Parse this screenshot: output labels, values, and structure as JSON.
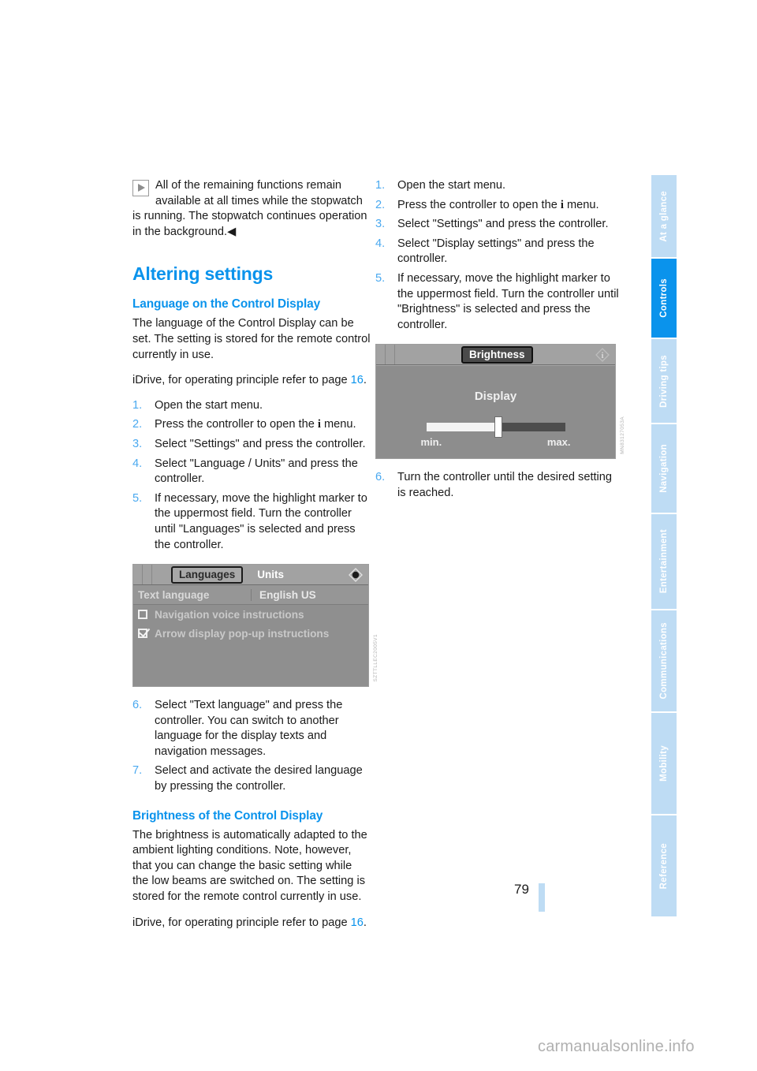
{
  "document": {
    "page_number": "79",
    "watermark": "carmanualsonline.info"
  },
  "sidebar": {
    "items": [
      {
        "label": "At a glance",
        "active": false
      },
      {
        "label": "Controls",
        "active": true
      },
      {
        "label": "Driving tips",
        "active": false
      },
      {
        "label": "Navigation",
        "active": false
      },
      {
        "label": "Entertainment",
        "active": false
      },
      {
        "label": "Communications",
        "active": false
      },
      {
        "label": "Mobility",
        "active": false
      },
      {
        "label": "Reference",
        "active": false
      }
    ],
    "active_color": "#0a93ec",
    "inactive_color": "#bedcf4"
  },
  "left_column": {
    "note": "All of the remaining functions remain available at all times while the stopwatch is running. The stopwatch continues operation in the background.◀",
    "section_heading": "Altering settings",
    "subsection_heading": "Language on the Control Display",
    "paragraph_1": "The language of the Control Display can be set. The setting is stored for the remote control currently in use.",
    "idrive_ref_prefix": "iDrive, for operating principle refer to page ",
    "idrive_ref_page": "16",
    "idrive_ref_suffix": ".",
    "steps": [
      {
        "num": "1.",
        "text": "Open the start menu."
      },
      {
        "num": "2.",
        "text": "Press the controller to open the i menu."
      },
      {
        "num": "3.",
        "text": "Select \"Settings\" and press the controller."
      },
      {
        "num": "4.",
        "text": "Select \"Language / Units\" and press the controller."
      },
      {
        "num": "5.",
        "text": "If necessary, move the highlight marker to the uppermost field. Turn the controller until \"Languages\" is selected and press the controller."
      }
    ],
    "steps_after": [
      {
        "num": "6.",
        "text": "Select \"Text language\" and press the controller. You can switch to another language for the display texts and navigation messages."
      },
      {
        "num": "7.",
        "text": "Select and activate the desired language by pressing the controller."
      }
    ],
    "subsection_heading_2": "Brightness of the Control Display",
    "paragraph_2": "The brightness is automatically adapted to the ambient lighting conditions. Note, however, that you can change the basic setting while the low beams are switched on. The setting is stored for the remote control currently in use.",
    "idrive_ref2_prefix": "iDrive, for operating principle refer to page ",
    "idrive_ref2_page": "16",
    "idrive_ref2_suffix": "."
  },
  "right_column": {
    "steps": [
      {
        "num": "1.",
        "text": "Open the start menu."
      },
      {
        "num": "2.",
        "text": "Press the controller to open the i menu."
      },
      {
        "num": "3.",
        "text": "Select \"Settings\" and press the controller."
      },
      {
        "num": "4.",
        "text": "Select \"Display settings\" and press the controller."
      },
      {
        "num": "5.",
        "text": "If necessary, move the highlight marker to the uppermost field. Turn the controller until \"Brightness\" is selected and press the controller."
      }
    ],
    "steps_after": [
      {
        "num": "6.",
        "text": "Turn the controller until the desired setting is reached."
      }
    ]
  },
  "screenshot_languages": {
    "tab_selected": "Languages",
    "tab_other": "Units",
    "row_label": "Text language",
    "row_value": "English US",
    "checkbox_1_label": "Navigation voice instructions",
    "checkbox_1_checked": false,
    "checkbox_2_label": "Arrow display pop-up instructions",
    "checkbox_2_checked": true,
    "image_id": "SZTTLLEC2005V1"
  },
  "screenshot_brightness": {
    "title_chip": "Brightness",
    "body_title": "Display",
    "slider_min_label": "min.",
    "slider_max_label": "max.",
    "slider_value_percent": 52,
    "image_id": "MN83127053A"
  }
}
